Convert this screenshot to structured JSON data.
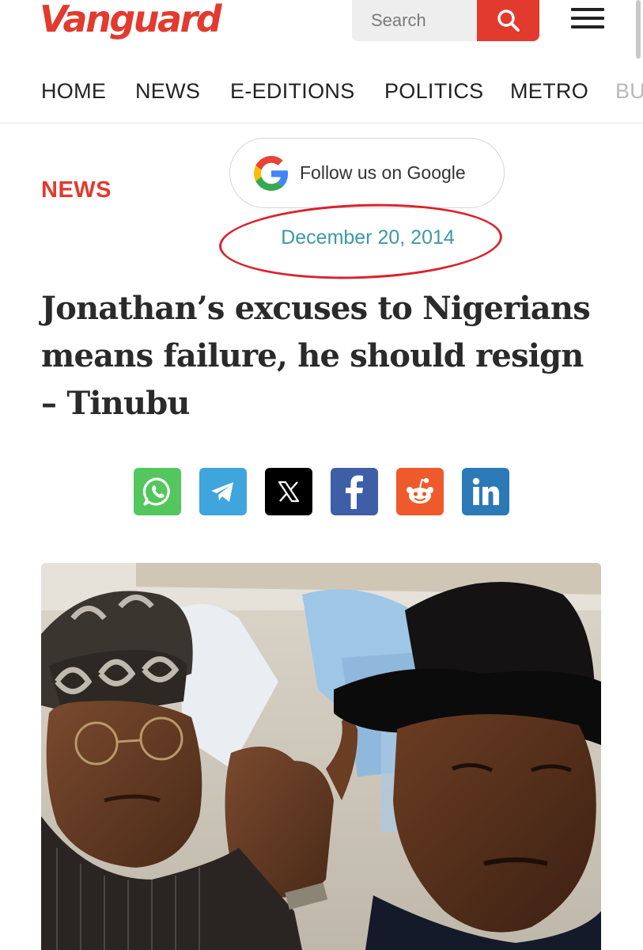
{
  "header": {
    "logo_text": "Vanguard",
    "search_placeholder": "Search",
    "brand_color": "#e23a2e"
  },
  "nav": {
    "items": [
      "HOME",
      "NEWS",
      "E-EDITIONS",
      "POLITICS",
      "METRO",
      "BU"
    ]
  },
  "article": {
    "category": "NEWS",
    "follow_label": "Follow us on Google",
    "date": "December 20, 2014",
    "headline": "Jonathan’s excuses to Nigerians means failure, he should resign – Tinubu"
  },
  "share": {
    "icons": [
      "whatsapp-icon",
      "telegram-icon",
      "x-icon",
      "facebook-icon",
      "reddit-icon",
      "linkedin-icon"
    ],
    "colors": {
      "whatsapp": "#53c75d",
      "telegram": "#3ea5dd",
      "x": "#000000",
      "facebook": "#3f5ea8",
      "reddit": "#ee5a2b",
      "linkedin": "#2b79b7"
    }
  }
}
